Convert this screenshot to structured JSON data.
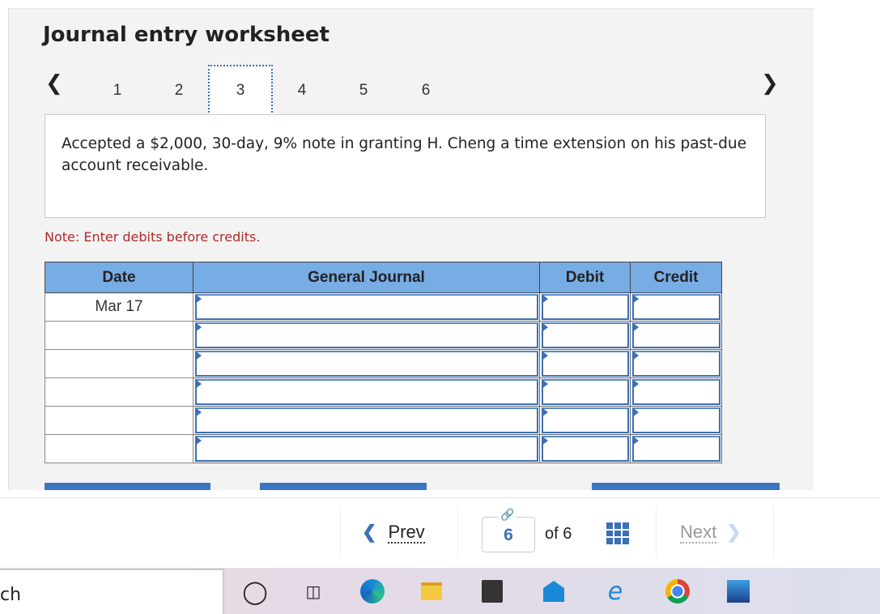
{
  "title": "Journal entry worksheet",
  "tabs": [
    {
      "label": "1"
    },
    {
      "label": "2"
    },
    {
      "label": "3",
      "active": true
    },
    {
      "label": "4"
    },
    {
      "label": "5"
    },
    {
      "label": "6"
    }
  ],
  "prompt": "Accepted a $2,000, 30-day, 9% note in granting H. Cheng a time extension on his past-due account receivable.",
  "note": "Note: Enter debits before credits.",
  "table": {
    "headers": [
      "Date",
      "General Journal",
      "Debit",
      "Credit"
    ],
    "rows": [
      {
        "date": "Mar 17",
        "account": "",
        "debit": "",
        "credit": ""
      },
      {
        "date": "",
        "account": "",
        "debit": "",
        "credit": ""
      },
      {
        "date": "",
        "account": "",
        "debit": "",
        "credit": ""
      },
      {
        "date": "",
        "account": "",
        "debit": "",
        "credit": ""
      },
      {
        "date": "",
        "account": "",
        "debit": "",
        "credit": ""
      },
      {
        "date": "",
        "account": "",
        "debit": "",
        "credit": ""
      }
    ]
  },
  "footer": {
    "prev": "Prev",
    "page": "6",
    "of": "of 6",
    "next": "Next"
  },
  "taskbar": {
    "search_text": "ch",
    "icons": [
      "cortana-icon",
      "task-view-icon",
      "edge-icon",
      "file-explorer-icon",
      "store-icon",
      "mail-icon",
      "internet-explorer-icon",
      "chrome-icon",
      "photos-icon"
    ]
  },
  "colors": {
    "accent": "#3b6fb6",
    "header": "#78ace4",
    "note": "#b02a2a"
  }
}
